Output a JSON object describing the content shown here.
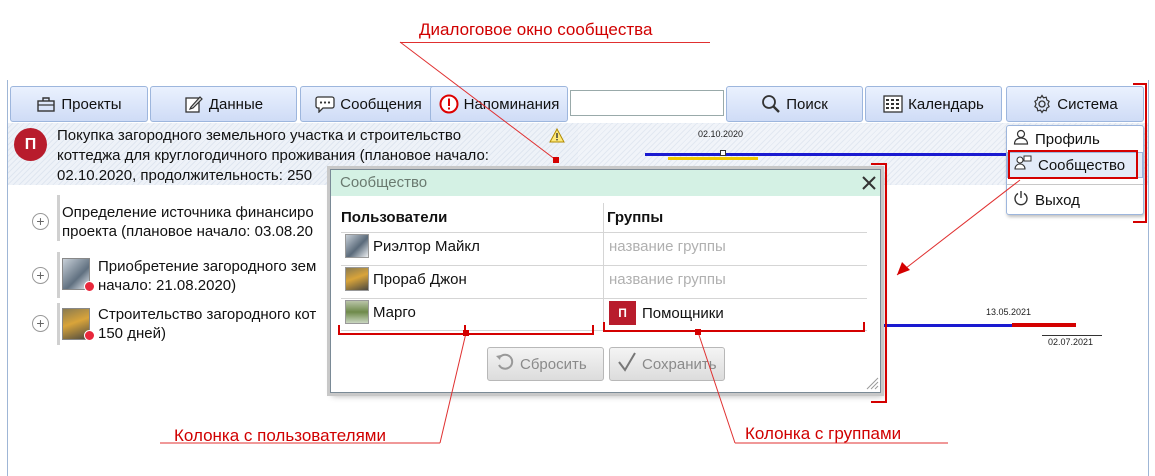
{
  "annotations": {
    "dialog": "Диалоговое окно сообщества",
    "users_column": "Колонка с пользователями",
    "groups_column": "Колонка с группами"
  },
  "toolbar": {
    "projects": "Проекты",
    "data": "Данные",
    "messages": "Сообщения",
    "reminders": "Напоминания",
    "search_value": "",
    "search": "Поиск",
    "calendar": "Календарь",
    "system": "Система"
  },
  "project": {
    "badge": "П",
    "line1": "Покупка загородного земельного участка и строительство",
    "line2": "коттеджа для круглогодичного проживания (плановое начало:",
    "line3": "02.10.2020, продолжительность: 250",
    "gantt_date": "02.10.2020"
  },
  "tasks": [
    {
      "line1": "Определение источника финансиро",
      "line2": "проекта (плановое начало: 03.08.20"
    },
    {
      "line1": "Приобретение загородного зем",
      "line2": "начало: 21.08.2020)"
    },
    {
      "line1": "Строительство загородного кот",
      "line2": "150 дней)"
    }
  ],
  "gantt_dates": {
    "d1": "13.05.2021",
    "d2": "02.07.2021"
  },
  "system_menu": {
    "profile": "Профиль",
    "community": "Сообщество",
    "exit": "Выход"
  },
  "dialog": {
    "title": "Сообщество",
    "col_users": "Пользователи",
    "col_groups": "Группы",
    "rows": [
      {
        "user": "Риэлтор Майкл",
        "group": "название группы",
        "group_placeholder": true
      },
      {
        "user": "Прораб Джон",
        "group": "название группы",
        "group_placeholder": true
      },
      {
        "user": "Марго",
        "group": "Помощники",
        "group_badge": "П"
      }
    ],
    "reset": "Сбросить",
    "save": "Сохранить"
  },
  "colors": {
    "accent_red": "#d40000",
    "toolbar_blue": "#cfdcf6",
    "dialog_title_bg": "#d4f1e4",
    "badge_red": "#b81c2c"
  }
}
